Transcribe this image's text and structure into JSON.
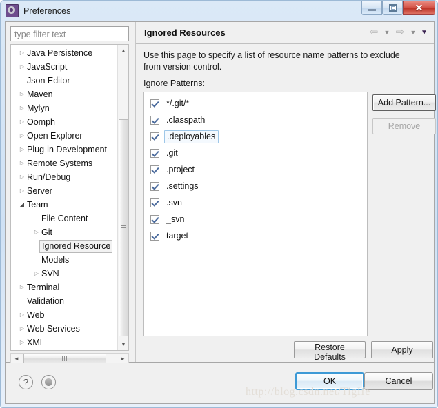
{
  "window": {
    "title": "Preferences",
    "icon": "preferences-gear-icon",
    "controls": {
      "minimize": "minimize-icon",
      "maximize": "restore-icon",
      "close": "✕"
    }
  },
  "sidebar": {
    "filter": {
      "placeholder": "type filter text",
      "value": ""
    },
    "items": [
      {
        "label": "Java Persistence",
        "level": 1,
        "twisty": "collapsed",
        "selected": false
      },
      {
        "label": "JavaScript",
        "level": 1,
        "twisty": "collapsed",
        "selected": false
      },
      {
        "label": "Json Editor",
        "level": 1,
        "twisty": "none",
        "selected": false
      },
      {
        "label": "Maven",
        "level": 1,
        "twisty": "collapsed",
        "selected": false
      },
      {
        "label": "Mylyn",
        "level": 1,
        "twisty": "collapsed",
        "selected": false
      },
      {
        "label": "Oomph",
        "level": 1,
        "twisty": "collapsed",
        "selected": false
      },
      {
        "label": "Open Explorer",
        "level": 1,
        "twisty": "collapsed",
        "selected": false
      },
      {
        "label": "Plug-in Development",
        "level": 1,
        "twisty": "collapsed",
        "selected": false
      },
      {
        "label": "Remote Systems",
        "level": 1,
        "twisty": "collapsed",
        "selected": false
      },
      {
        "label": "Run/Debug",
        "level": 1,
        "twisty": "collapsed",
        "selected": false
      },
      {
        "label": "Server",
        "level": 1,
        "twisty": "collapsed",
        "selected": false
      },
      {
        "label": "Team",
        "level": 1,
        "twisty": "expanded",
        "selected": false
      },
      {
        "label": "File Content",
        "level": 2,
        "twisty": "none",
        "selected": false
      },
      {
        "label": "Git",
        "level": 2,
        "twisty": "collapsed",
        "selected": false
      },
      {
        "label": "Ignored Resource",
        "level": 2,
        "twisty": "none",
        "selected": true
      },
      {
        "label": "Models",
        "level": 2,
        "twisty": "none",
        "selected": false
      },
      {
        "label": "SVN",
        "level": 2,
        "twisty": "collapsed",
        "selected": false
      },
      {
        "label": "Terminal",
        "level": 1,
        "twisty": "collapsed",
        "selected": false
      },
      {
        "label": "Validation",
        "level": 1,
        "twisty": "none",
        "selected": false
      },
      {
        "label": "Web",
        "level": 1,
        "twisty": "collapsed",
        "selected": false
      },
      {
        "label": "Web Services",
        "level": 1,
        "twisty": "collapsed",
        "selected": false
      },
      {
        "label": "XML",
        "level": 1,
        "twisty": "collapsed",
        "selected": false
      }
    ],
    "twisty_glyphs": {
      "collapsed": "▷",
      "expanded": "◢",
      "none": ""
    },
    "vertical_scrollbar": {
      "up": "▲",
      "down": "▼"
    },
    "horizontal_scrollbar": {
      "left": "◄",
      "right": "►"
    }
  },
  "page": {
    "title": "Ignored Resources",
    "description": "Use this page to specify a list of resource name patterns to exclude from version control.",
    "section_label": "Ignore Patterns:",
    "nav": {
      "back": "⇦",
      "back_caret": "▼",
      "forward": "⇨",
      "forward_caret": "▼",
      "menu_caret": "▼"
    },
    "patterns": [
      {
        "label": "*/.git/*",
        "checked": true,
        "selected": false
      },
      {
        "label": ".classpath",
        "checked": true,
        "selected": false
      },
      {
        "label": ".deployables",
        "checked": true,
        "selected": true
      },
      {
        "label": ".git",
        "checked": true,
        "selected": false
      },
      {
        "label": ".project",
        "checked": true,
        "selected": false
      },
      {
        "label": ".settings",
        "checked": true,
        "selected": false
      },
      {
        "label": ".svn",
        "checked": true,
        "selected": false
      },
      {
        "label": "_svn",
        "checked": true,
        "selected": false
      },
      {
        "label": "target",
        "checked": true,
        "selected": false
      }
    ],
    "buttons": {
      "add_pattern": "Add Pattern...",
      "remove": "Remove",
      "restore_defaults": "Restore Defaults",
      "apply": "Apply"
    }
  },
  "footer": {
    "help_icon": "?",
    "ok": "OK",
    "cancel": "Cancel"
  },
  "watermark": "http://blog.csdn.net/TigIfe",
  "colors": {
    "titlebar_accent": "#cfe1f4",
    "close_button": "#bb3226",
    "focus_ring": "#3d9ad6",
    "checkmark": "#4a6a9c",
    "selection_border": "#9ec7e8"
  }
}
